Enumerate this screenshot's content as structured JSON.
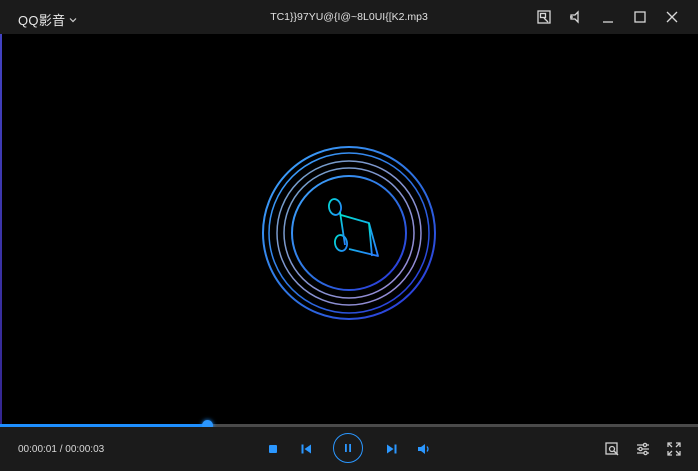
{
  "app": {
    "brand": "QQ影音",
    "file_title": "TC1}}97YU@{I@~8L0UI{[K2.mp3"
  },
  "window_controls": [
    "mini-mode-icon",
    "pin-icon",
    "minimize-icon",
    "maximize-icon",
    "close-icon"
  ],
  "player": {
    "time_display": "00:00:01 / 00:00:03",
    "progress": 0.296,
    "state": "playing",
    "media_icon": "music-note-disc-icon"
  },
  "controls": [
    "stop-icon",
    "previous-icon",
    "pause-icon",
    "next-icon",
    "volume-icon"
  ],
  "right_controls": [
    "screenshot-icon",
    "settings-icon",
    "fullscreen-icon"
  ],
  "colors": {
    "accent": "#1e8fff",
    "bar_bg": "#1b1b1b",
    "video_bg": "#000000"
  }
}
